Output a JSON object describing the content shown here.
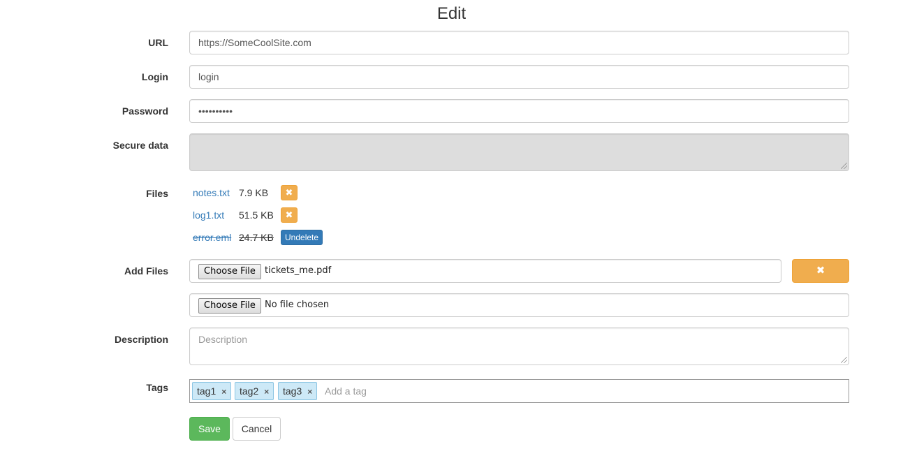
{
  "page": {
    "title": "Edit"
  },
  "form": {
    "url": {
      "label": "URL",
      "value": "https://SomeCoolSite.com"
    },
    "login": {
      "label": "Login",
      "value": "login"
    },
    "password": {
      "label": "Password",
      "value": "••••••••••"
    },
    "secure_data": {
      "label": "Secure data",
      "value": ""
    },
    "files": {
      "label": "Files",
      "items": [
        {
          "name": "notes.txt",
          "size": "7.9 KB",
          "action": "remove",
          "action_icon": "close-icon",
          "action_glyph": "✖"
        },
        {
          "name": "log1.txt",
          "size": "51.5 KB",
          "action": "remove",
          "action_icon": "close-icon",
          "action_glyph": "✖"
        },
        {
          "name": "error.eml",
          "size": "24.7 KB",
          "deleted": true,
          "action_label": "Undelete"
        }
      ]
    },
    "add_files": {
      "label": "Add Files",
      "inputs": [
        {
          "button_label": "Choose File",
          "file_name": "tickets_me.pdf"
        },
        {
          "button_label": "Choose File",
          "file_name": "No file chosen"
        }
      ],
      "remove_icon": "close-icon",
      "remove_glyph": "✖"
    },
    "description": {
      "label": "Description",
      "placeholder": "Description"
    },
    "tags": {
      "label": "Tags",
      "items": [
        "tag1",
        "tag2",
        "tag3"
      ],
      "remove_glyph": "×",
      "placeholder": "Add a tag"
    },
    "actions": {
      "save_label": "Save",
      "cancel_label": "Cancel"
    }
  },
  "colors": {
    "primary": "#337ab7",
    "warning": "#f0ad4e",
    "success": "#5cb85c",
    "tag_bg": "#cde9f7",
    "disabled_bg": "#dddddd"
  }
}
